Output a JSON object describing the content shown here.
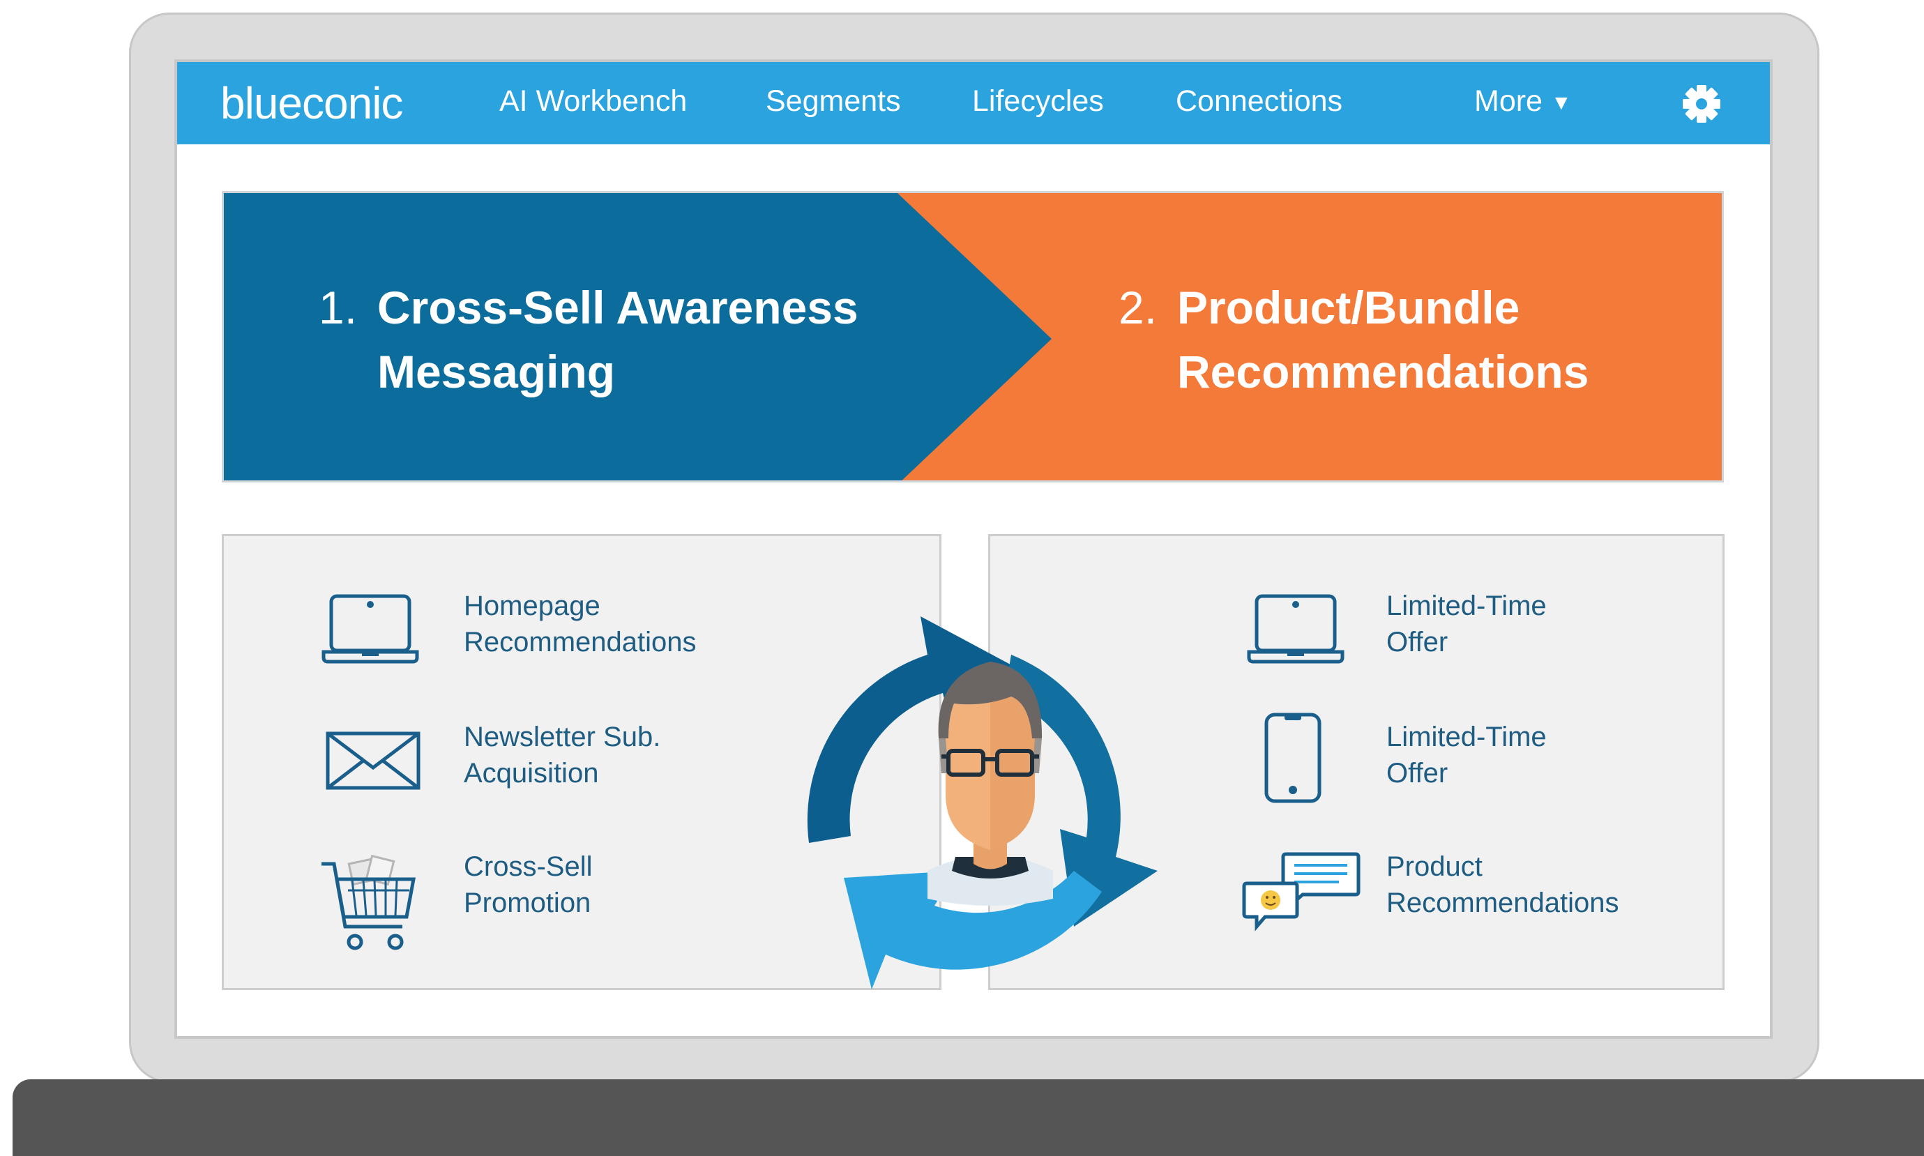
{
  "nav": {
    "brand": "blueconic",
    "items": [
      "AI Workbench",
      "Segments",
      "Lifecycles",
      "Connections"
    ],
    "more_label": "More",
    "more_caret": "▼"
  },
  "banner": {
    "step1": {
      "number": "1.",
      "line1": "Cross-Sell Awareness",
      "line2": "Messaging"
    },
    "step2": {
      "number": "2.",
      "line1": "Product/Bundle",
      "line2": "Recommendations"
    }
  },
  "left_panel": {
    "items": [
      {
        "icon": "laptop-icon",
        "line1": "Homepage",
        "line2": "Recommendations"
      },
      {
        "icon": "envelope-icon",
        "line1": "Newsletter Sub.",
        "line2": "Acquisition"
      },
      {
        "icon": "shopping-cart-icon",
        "line1": "Cross-Sell",
        "line2": "Promotion"
      }
    ]
  },
  "right_panel": {
    "items": [
      {
        "icon": "laptop-icon",
        "line1": "Limited-Time",
        "line2": "Offer"
      },
      {
        "icon": "smartphone-icon",
        "line1": "Limited-Time",
        "line2": "Offer"
      },
      {
        "icon": "chat-bubbles-icon",
        "line1": "Product",
        "line2": "Recommendations"
      }
    ]
  },
  "colors": {
    "nav_bg": "#2aa3df",
    "step1_bg": "#0c6c9b",
    "step2_bg": "#f47a3a",
    "label_text": "#1e5c82",
    "icon_stroke": "#1a5f8b",
    "laptop_frame": "#dcdcdc",
    "laptop_base": "#555555"
  }
}
